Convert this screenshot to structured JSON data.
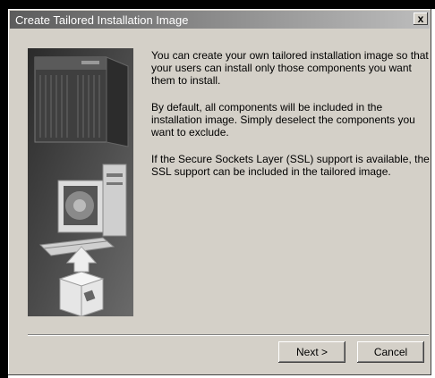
{
  "window": {
    "title": "Create Tailored Installation Image",
    "close_label": "x"
  },
  "description": {
    "paragraph_1": "You can create your own tailored installation image so that your users can install only those components you want them to install.",
    "paragraph_2": "By default, all components will be included in the installation image.  Simply deselect the components you want to exclude.",
    "paragraph_3": "If the Secure Sockets Layer (SSL) support is available, the SSL support can be included in the tailored image."
  },
  "buttons": {
    "next_label": "Next >",
    "cancel_label": "Cancel"
  },
  "icons": [
    "server-icon",
    "computer-icon",
    "package-icon"
  ]
}
